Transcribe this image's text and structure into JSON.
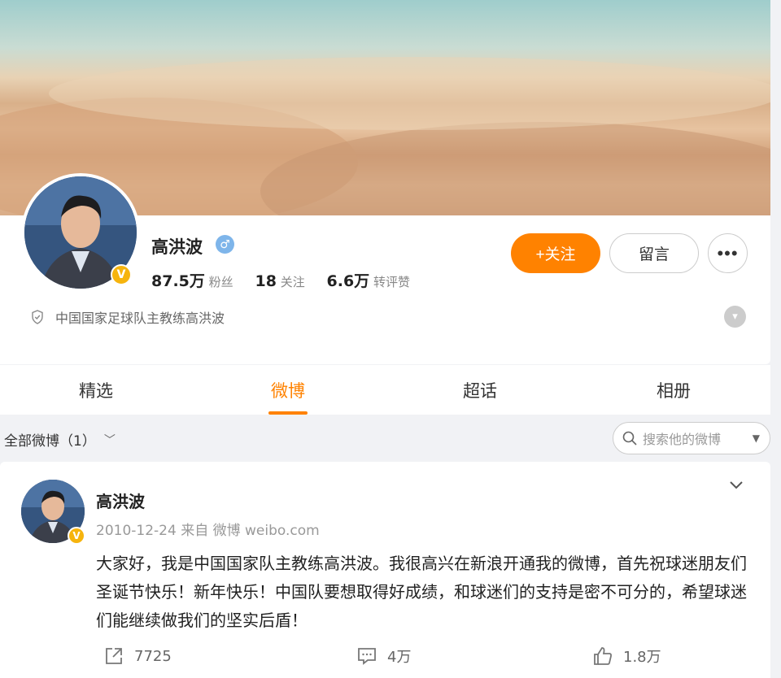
{
  "profile": {
    "name": "高洪波",
    "stats": {
      "followers_value": "87.5万",
      "followers_label": "粉丝",
      "following_value": "18",
      "following_label": "关注",
      "likes_value": "6.6万",
      "likes_label": "转评赞"
    },
    "follow_button": "+关注",
    "message_button": "留言",
    "more_button": "•••",
    "bio": "中国国家足球队主教练高洪波"
  },
  "tabs": [
    {
      "label": "精选",
      "active": false
    },
    {
      "label": "微博",
      "active": true
    },
    {
      "label": "超话",
      "active": false
    },
    {
      "label": "相册",
      "active": false
    }
  ],
  "filter": {
    "label": "全部微博（1）",
    "search_placeholder": "搜索他的微博"
  },
  "post": {
    "author": "高洪波",
    "meta": "2010-12-24 来自 微博 weibo.com",
    "text": "大家好，我是中国国家队主教练高洪波。我很高兴在新浪开通我的微博，首先祝球迷朋友们圣诞节快乐！新年快乐！中国队要想取得好成绩，和球迷们的支持是密不可分的，希望球迷们能继续做我们的坚实后盾！",
    "repost_count": "7725",
    "comment_count": "4万",
    "like_count": "1.8万"
  },
  "colors": {
    "accent": "#ff8200",
    "verified": "#f6b40e",
    "gender_male": "#7eb5ea"
  },
  "icons": [
    "verified-badge-icon",
    "male-gender-icon",
    "shield-icon",
    "chevron-down-icon",
    "search-icon",
    "repost-icon",
    "comment-icon",
    "like-icon"
  ]
}
